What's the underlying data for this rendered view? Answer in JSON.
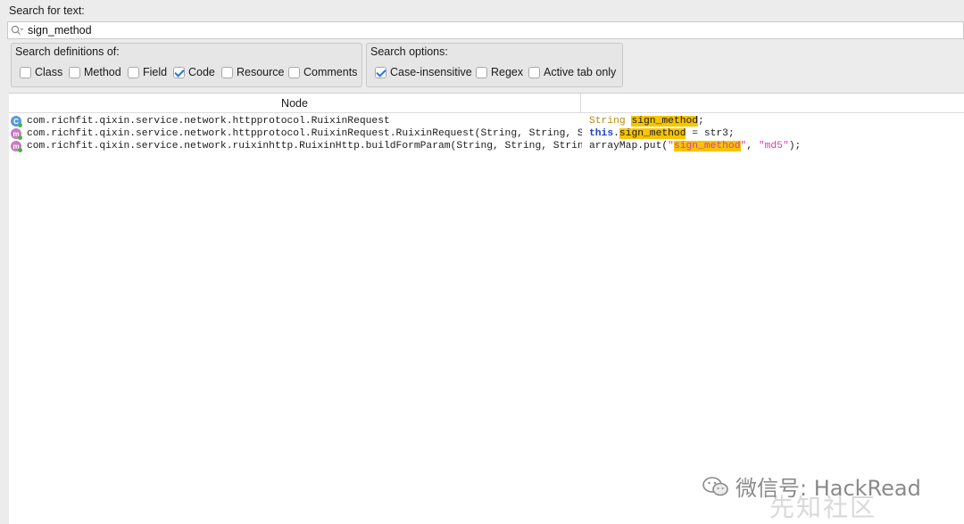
{
  "search": {
    "label": "Search for text:",
    "value": "sign_method",
    "placeholder": ""
  },
  "definitions": {
    "title": "Search definitions of:",
    "options": [
      {
        "label": "Class",
        "checked": false
      },
      {
        "label": "Method",
        "checked": false
      },
      {
        "label": "Field",
        "checked": false
      },
      {
        "label": "Code",
        "checked": true
      },
      {
        "label": "Resource",
        "checked": false
      },
      {
        "label": "Comments",
        "checked": false
      }
    ]
  },
  "search_options": {
    "title": "Search options:",
    "options": [
      {
        "label": "Case-insensitive",
        "checked": true
      },
      {
        "label": "Regex",
        "checked": false
      },
      {
        "label": "Active tab only",
        "checked": false
      }
    ]
  },
  "results": {
    "column_node": "Node",
    "column_code": "",
    "rows": [
      {
        "icon": "class-icon",
        "icon_letter": "C",
        "node": "com.richfit.qixin.service.network.httpprotocol.RuixinRequest",
        "code": {
          "pre_type": "String ",
          "hl": "sign_method",
          "post": ";"
        }
      },
      {
        "icon": "method-icon",
        "icon_letter": "m",
        "node": "com.richfit.qixin.service.network.httpprotocol.RuixinRequest.RuixinRequest(String, String, String, String, String, String)",
        "code": {
          "pre_this": "this",
          "dot": ".",
          "hl": "sign_method",
          "post": " = str3;"
        }
      },
      {
        "icon": "method-icon",
        "icon_letter": "m",
        "node": "com.richfit.qixin.service.network.ruixinhttp.RuixinHttp.buildFormParam(String, String, String, boolean)",
        "code": {
          "pre": "arrayMap.put(",
          "q1": "\"",
          "hl": "sign_method",
          "q2": "\"",
          "mid": ", ",
          "str2": "\"md5\"",
          "post": ");"
        }
      }
    ]
  },
  "watermark": {
    "text": "微信号: HackRead",
    "corner": "先知社区"
  }
}
